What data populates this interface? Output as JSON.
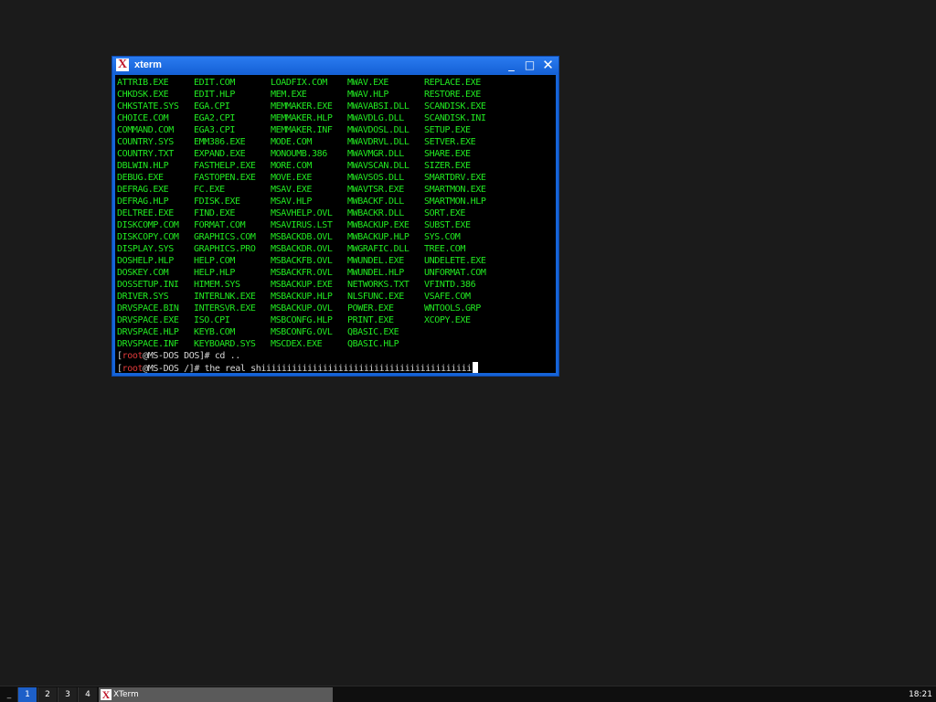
{
  "window": {
    "title": "xterm",
    "icon": "x-logo-icon",
    "icon_glyph": "X",
    "buttons": {
      "minimize": "_",
      "maximize": "□",
      "close": "✕"
    }
  },
  "terminal": {
    "listing": [
      [
        "ATTRIB.EXE",
        "EDIT.COM",
        "LOADFIX.COM",
        "MWAV.EXE",
        "REPLACE.EXE"
      ],
      [
        "CHKDSK.EXE",
        "EDIT.HLP",
        "MEM.EXE",
        "MWAV.HLP",
        "RESTORE.EXE"
      ],
      [
        "CHKSTATE.SYS",
        "EGA.CPI",
        "MEMMAKER.EXE",
        "MWAVABSI.DLL",
        "SCANDISK.EXE"
      ],
      [
        "CHOICE.COM",
        "EGA2.CPI",
        "MEMMAKER.HLP",
        "MWAVDLG.DLL",
        "SCANDISK.INI"
      ],
      [
        "COMMAND.COM",
        "EGA3.CPI",
        "MEMMAKER.INF",
        "MWAVDOSL.DLL",
        "SETUP.EXE"
      ],
      [
        "COUNTRY.SYS",
        "EMM386.EXE",
        "MODE.COM",
        "MWAVDRVL.DLL",
        "SETVER.EXE"
      ],
      [
        "COUNTRY.TXT",
        "EXPAND.EXE",
        "MONOUMB.386",
        "MWAVMGR.DLL",
        "SHARE.EXE"
      ],
      [
        "DBLWIN.HLP",
        "FASTHELP.EXE",
        "MORE.COM",
        "MWAVSCAN.DLL",
        "SIZER.EXE"
      ],
      [
        "DEBUG.EXE",
        "FASTOPEN.EXE",
        "MOVE.EXE",
        "MWAVSOS.DLL",
        "SMARTDRV.EXE"
      ],
      [
        "DEFRAG.EXE",
        "FC.EXE",
        "MSAV.EXE",
        "MWAVTSR.EXE",
        "SMARTMON.EXE"
      ],
      [
        "DEFRAG.HLP",
        "FDISK.EXE",
        "MSAV.HLP",
        "MWBACKF.DLL",
        "SMARTMON.HLP"
      ],
      [
        "DELTREE.EXE",
        "FIND.EXE",
        "MSAVHELP.OVL",
        "MWBACKR.DLL",
        "SORT.EXE"
      ],
      [
        "DISKCOMP.COM",
        "FORMAT.COM",
        "MSAVIRUS.LST",
        "MWBACKUP.EXE",
        "SUBST.EXE"
      ],
      [
        "DISKCOPY.COM",
        "GRAPHICS.COM",
        "MSBACKDB.OVL",
        "MWBACKUP.HLP",
        "SYS.COM"
      ],
      [
        "DISPLAY.SYS",
        "GRAPHICS.PRO",
        "MSBACKDR.OVL",
        "MWGRAFIC.DLL",
        "TREE.COM"
      ],
      [
        "DOSHELP.HLP",
        "HELP.COM",
        "MSBACKFB.OVL",
        "MWUNDEL.EXE",
        "UNDELETE.EXE"
      ],
      [
        "DOSKEY.COM",
        "HELP.HLP",
        "MSBACKFR.OVL",
        "MWUNDEL.HLP",
        "UNFORMAT.COM"
      ],
      [
        "DOSSETUP.INI",
        "HIMEM.SYS",
        "MSBACKUP.EXE",
        "NETWORKS.TXT",
        "VFINTD.386"
      ],
      [
        "DRIVER.SYS",
        "INTERLNK.EXE",
        "MSBACKUP.HLP",
        "NLSFUNC.EXE",
        "VSAFE.COM"
      ],
      [
        "DRVSPACE.BIN",
        "INTERSVR.EXE",
        "MSBACKUP.OVL",
        "POWER.EXE",
        "WNTOOLS.GRP"
      ],
      [
        "DRVSPACE.EXE",
        "ISO.CPI",
        "MSBCONFG.HLP",
        "PRINT.EXE",
        "XCOPY.EXE"
      ],
      [
        "DRVSPACE.HLP",
        "KEYB.COM",
        "MSBCONFG.OVL",
        "QBASIC.EXE",
        ""
      ],
      [
        "DRVSPACE.INF",
        "KEYBOARD.SYS",
        "MSCDEX.EXE",
        "QBASIC.HLP",
        ""
      ]
    ],
    "prompt1": {
      "open": "[",
      "user": "root",
      "host": "@MS-DOS",
      "path": " DOS",
      "close": "]# ",
      "command": "cd .."
    },
    "prompt2": {
      "open": "[",
      "user": "root",
      "host": "@MS-DOS",
      "path": " /",
      "close": "]# ",
      "command": "the real shiiiiiiiiiiiiiiiiiiiiiiiiiiiiiiiiiiiiiiiii"
    }
  },
  "taskbar": {
    "show_desktop": "_",
    "workspaces": [
      "1",
      "2",
      "3",
      "4"
    ],
    "active_workspace": "1",
    "task": {
      "label": "XTerm",
      "icon": "x-logo-icon",
      "icon_glyph": "X"
    },
    "clock": "18:21"
  },
  "colors": {
    "desktop": "#1b1b1b",
    "titlebar": "#1664d8",
    "terminal_bg": "#000000",
    "listing_text": "#21e821",
    "prompt_user": "#e03a3a",
    "taskbar_active": "#1d5fc8"
  }
}
